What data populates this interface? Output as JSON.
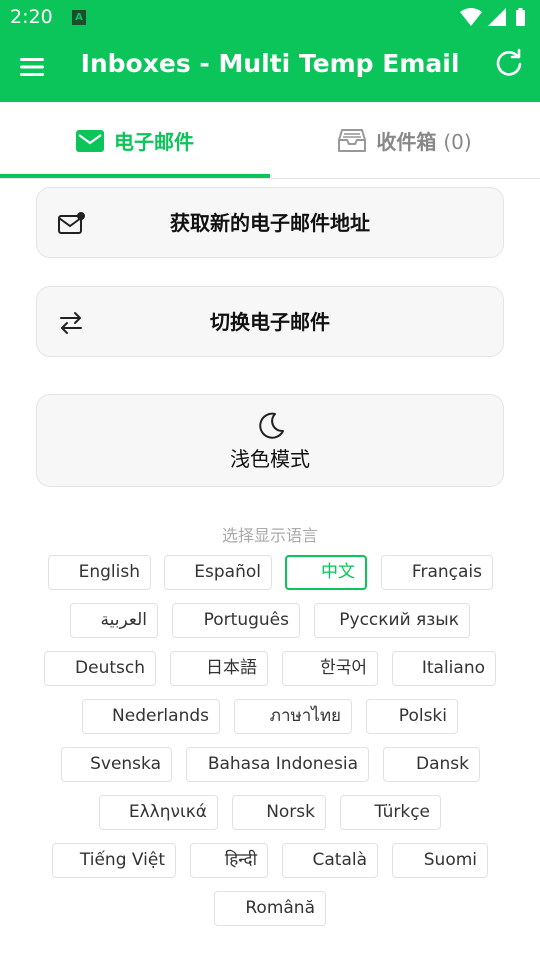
{
  "status": {
    "time": "2:20",
    "notification_icon": "a-icon",
    "right_icons": [
      "wifi-icon",
      "signal-icon",
      "battery-icon"
    ]
  },
  "toolbar": {
    "title": "Inboxes - Multi Temp Email",
    "menu_icon": "menu-icon",
    "refresh_icon": "refresh-icon"
  },
  "tabs": [
    {
      "label": "电子邮件",
      "icon": "mail-icon",
      "active": true
    },
    {
      "label": "收件箱",
      "count": "(0)",
      "icon": "inbox-tray-icon",
      "active": false
    }
  ],
  "actions": {
    "new_address": "获取新的电子邮件地址",
    "switch_email": "切换电子邮件",
    "theme": "浅色模式"
  },
  "language": {
    "heading": "选择显示语言",
    "selected": "中文",
    "options": [
      "English",
      "Español",
      "中文",
      "Français",
      "العربية",
      "Português",
      "Русский язык",
      "Deutsch",
      "日本語",
      "한국어",
      "Italiano",
      "Nederlands",
      "ภาษาไทย",
      "Polski",
      "Svenska",
      "Bahasa Indonesia",
      "Dansk",
      "Ελληνικά",
      "Norsk",
      "Türkçe",
      "Tiếng Việt",
      "हिन्दी",
      "Català",
      "Suomi",
      "Română"
    ]
  },
  "colors": {
    "accent": "#0bc45a",
    "card_bg": "#f7f7f7",
    "muted_text": "#888888"
  }
}
